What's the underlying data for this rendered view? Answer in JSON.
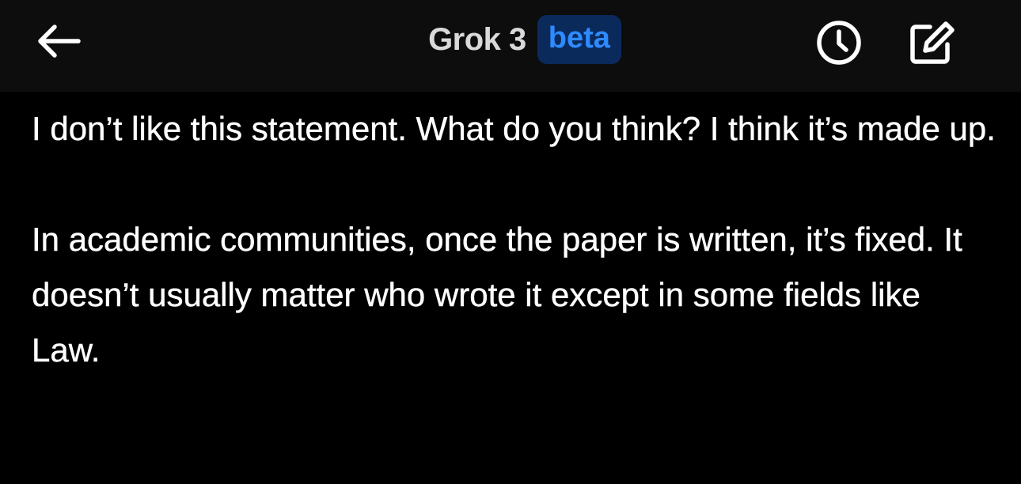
{
  "header": {
    "title": "Grok 3",
    "badge": "beta",
    "back_icon": "arrow-left-icon",
    "history_icon": "clock-icon",
    "compose_icon": "compose-icon"
  },
  "message": {
    "paragraphs": [
      "I don’t like this statement. What do you think? I think it’s made up.",
      "In academic communities, once the paper is written, it’s fixed. It doesn’t usually matter who wrote it except in some fields like Law."
    ]
  },
  "colors": {
    "background": "#000000",
    "header_background": "#0d0d0d",
    "badge_background": "#0b2a5c",
    "badge_text": "#2e8bff",
    "text": "#ffffff"
  }
}
